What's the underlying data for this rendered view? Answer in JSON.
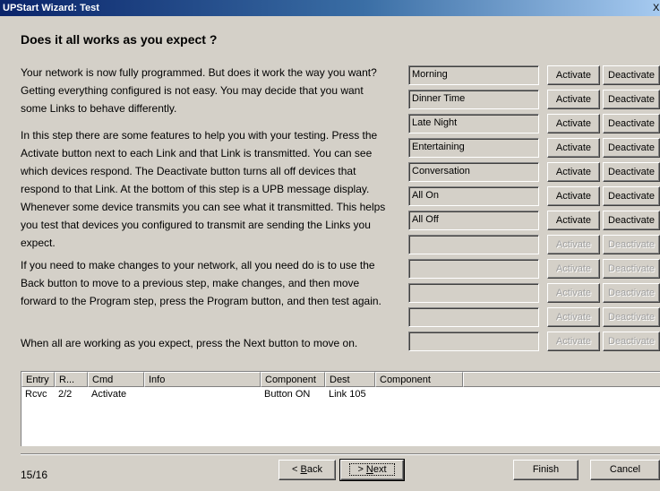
{
  "window": {
    "title": "UPStart Wizard: Test",
    "close_glyph": "X"
  },
  "heading": "Does it all works as you expect ?",
  "paragraphs": [
    "Your network is now fully programmed. But does it work the way you want? Getting everything configured is not easy. You may decide that you want some Links to behave differently.",
    "In this step there are some features to help you with your testing. Press the Activate button next to each Link and that Link is transmitted. You can see which devices respond. The Deactivate button turns all off devices that respond to that Link. At the bottom of this step is a UPB message display. Whenever some device transmits you can see what it transmitted. This helps you test that devices you configured to transmit are sending the Links you expect.",
    "If you need to make changes to your network, all you need do is to use the Back button to move to a previous step, make changes, and then move forward to the Program step, press the Program button, and then test again.",
    "When all are working as you expect, press the Next button to move on."
  ],
  "links": [
    {
      "name": "Morning",
      "enabled": true
    },
    {
      "name": "Dinner Time",
      "enabled": true
    },
    {
      "name": "Late Night",
      "enabled": true
    },
    {
      "name": "Entertaining",
      "enabled": true
    },
    {
      "name": "Conversation",
      "enabled": true
    },
    {
      "name": "All On",
      "enabled": true
    },
    {
      "name": "All Off",
      "enabled": true
    },
    {
      "name": "",
      "enabled": false
    },
    {
      "name": "",
      "enabled": false
    },
    {
      "name": "",
      "enabled": false
    },
    {
      "name": "",
      "enabled": false
    },
    {
      "name": "",
      "enabled": false
    }
  ],
  "buttons": {
    "activate": "Activate",
    "deactivate": "Deactivate"
  },
  "log": {
    "columns": [
      "Entry",
      "R...",
      "Cmd",
      "Info",
      "Component",
      "Dest",
      "Component"
    ],
    "rows": [
      [
        "Rcvc",
        "2/2",
        "Activate",
        "",
        "Button ON",
        "Link 105",
        ""
      ]
    ]
  },
  "footer": {
    "step": "15/16",
    "back_prefix": "< ",
    "back_key": "B",
    "back_rest": "ack",
    "next_prefix": "> ",
    "next_key": "N",
    "next_rest": "ext",
    "finish": "Finish",
    "cancel": "Cancel"
  },
  "colors": {
    "titlebar_start": "#0a246a",
    "titlebar_end": "#a6caf0",
    "face": "#d4d0c8"
  }
}
